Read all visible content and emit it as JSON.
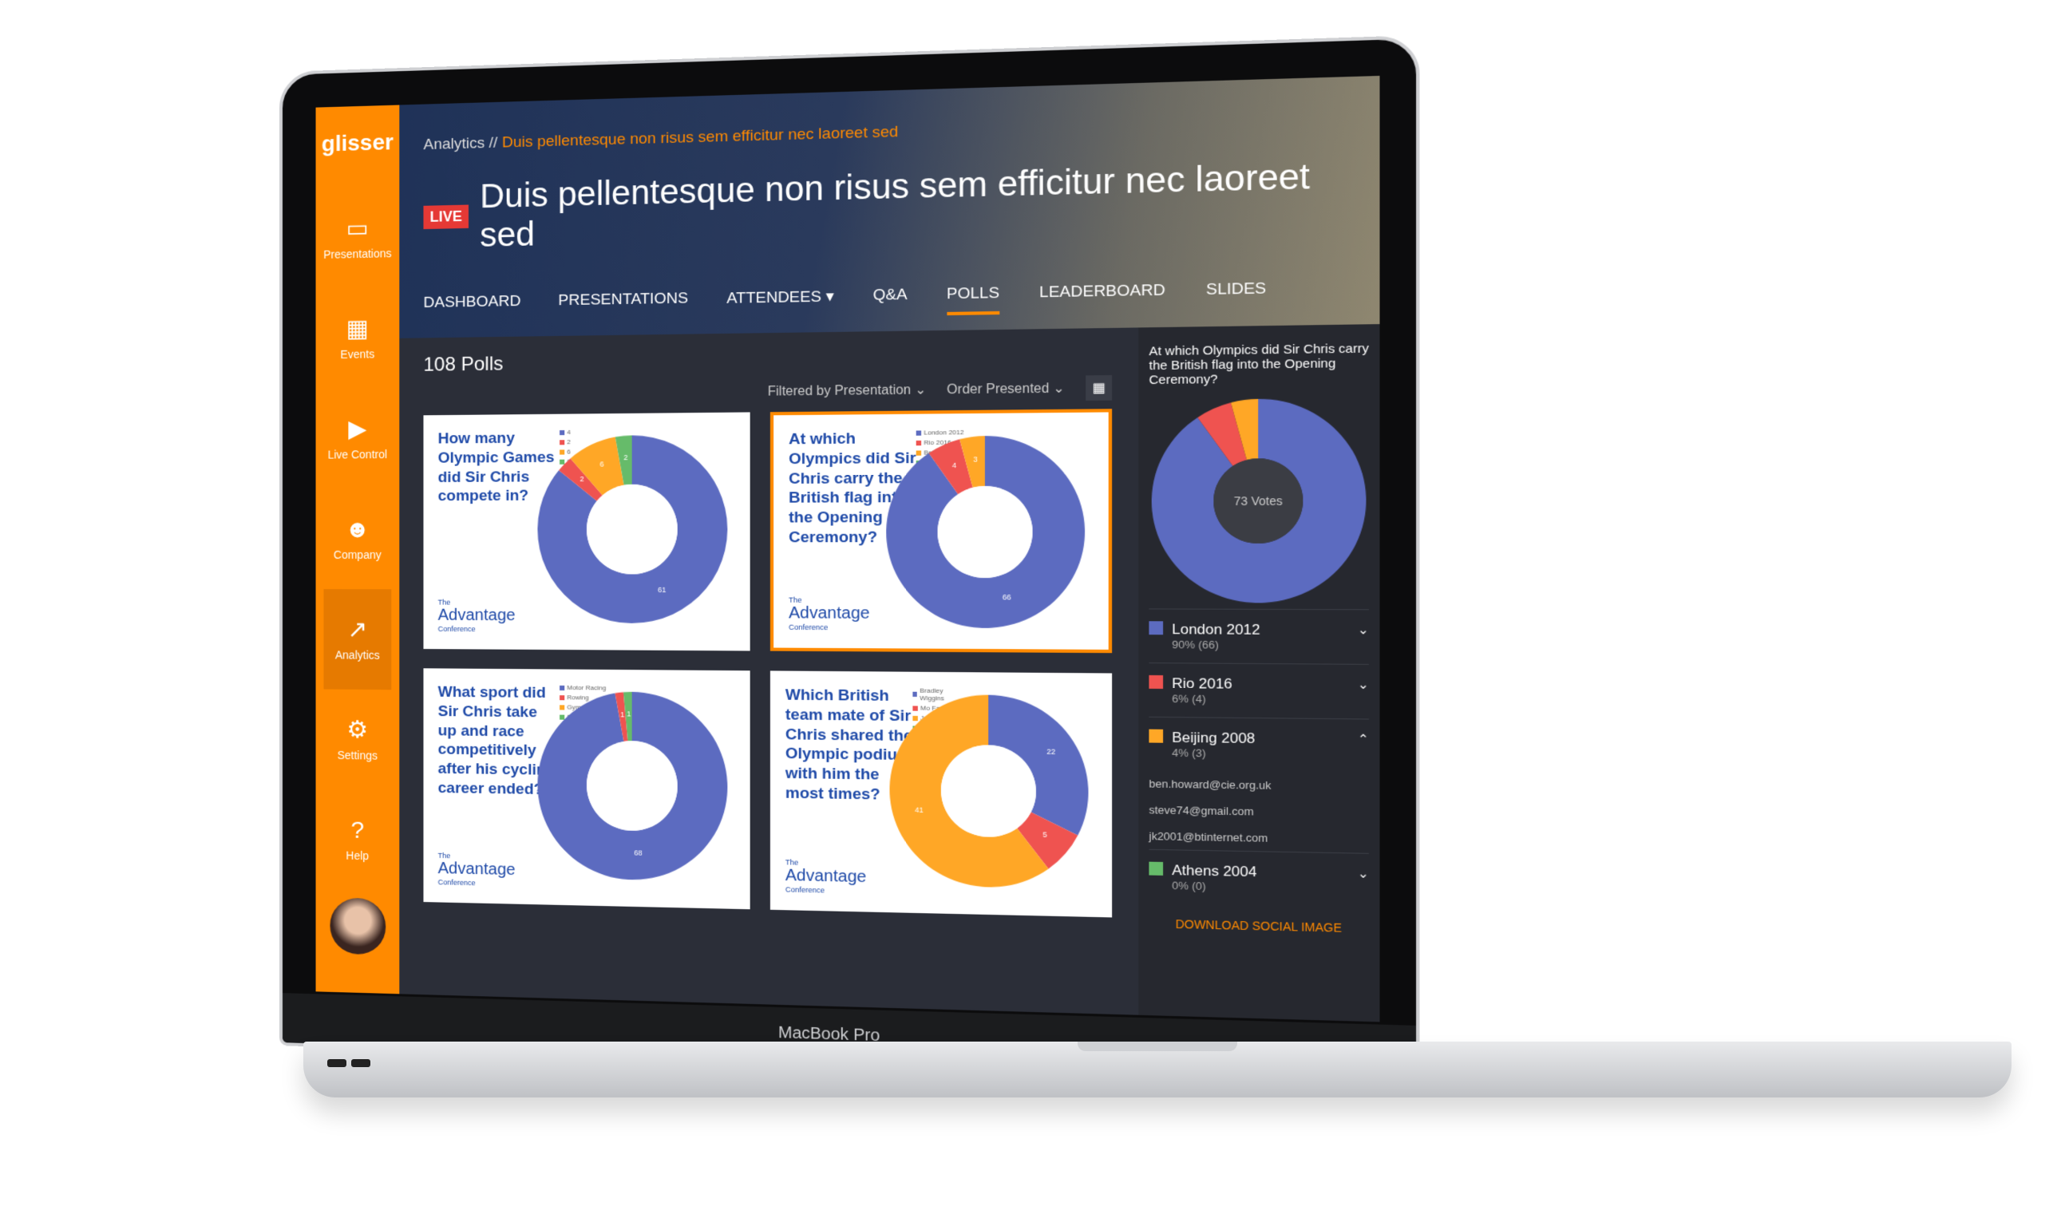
{
  "device_label": "MacBook Pro",
  "sidebar": {
    "logo": "glisser",
    "items": [
      {
        "label": "Presentations",
        "icon": "monitor-icon",
        "glyph": "▭"
      },
      {
        "label": "Events",
        "icon": "calendar-icon",
        "glyph": "▦"
      },
      {
        "label": "Live Control",
        "icon": "play-icon",
        "glyph": "▶"
      },
      {
        "label": "Company",
        "icon": "people-icon",
        "glyph": "☻"
      },
      {
        "label": "Analytics",
        "icon": "chart-icon",
        "glyph": "↗",
        "active": true
      },
      {
        "label": "Settings",
        "icon": "gear-icon",
        "glyph": "⚙"
      },
      {
        "label": "Help",
        "icon": "help-icon",
        "glyph": "?"
      }
    ]
  },
  "header": {
    "breadcrumb_root": "Analytics //",
    "breadcrumb_current": "Duis pellentesque non risus sem efficitur nec laoreet sed",
    "live_badge": "LIVE",
    "title": "Duis pellentesque non risus sem efficitur nec laoreet sed",
    "tabs": [
      "DASHBOARD",
      "PRESENTATIONS",
      "ATTENDEES ▾",
      "Q&A",
      "POLLS",
      "LEADERBOARD",
      "SLIDES"
    ],
    "active_tab": "POLLS"
  },
  "polls": {
    "count": "108 Polls",
    "filter": "Filtered by Presentation ⌄",
    "order": "Order Presented ⌄",
    "brand": {
      "the": "The",
      "name": "Advantage",
      "sub": "Conference"
    },
    "cards": [
      {
        "question": "How many Olympic Games did Sir Chris compete in?",
        "legend": [
          "4",
          "2",
          "6",
          "8"
        ],
        "values": [
          61,
          2,
          6,
          2
        ]
      },
      {
        "question": "At which Olympics did Sir Chris carry the British flag into the Opening Ceremony?",
        "legend": [
          "London 2012",
          "Rio 2016",
          "Beijing 2008",
          "Athens 2004"
        ],
        "values": [
          66,
          4,
          3,
          0
        ],
        "selected": true
      },
      {
        "question": "What sport did Sir Chris take up and race competitively after his cycling career ended?",
        "legend": [
          "Motor Racing",
          "Rowing",
          "Gymnastics",
          "Swimming"
        ],
        "values": [
          68,
          1,
          0,
          1
        ]
      },
      {
        "question": "Which British team mate of Sir Chris shared the Olympic podium with him the most times?",
        "legend": [
          "Bradley Wiggins",
          "Mo Farah",
          "Jason Kenny",
          "Tom Daley"
        ],
        "values": [
          22,
          5,
          41,
          0
        ]
      }
    ]
  },
  "colors": [
    "#5c6bc0",
    "#ef5350",
    "#ffa726",
    "#66bb6a"
  ],
  "panel": {
    "question": "At which Olympics did Sir Chris carry the British flag into the Opening Ceremony?",
    "total": "73 Votes",
    "options": [
      {
        "name": "London 2012",
        "stat": "90% (66)",
        "value": 66,
        "chev": "⌄"
      },
      {
        "name": "Rio 2016",
        "stat": "6% (4)",
        "value": 4,
        "chev": "⌄"
      },
      {
        "name": "Beijing 2008",
        "stat": "4% (3)",
        "value": 3,
        "chev": "⌃",
        "voters": [
          "ben.howard@cie.org.uk",
          "steve74@gmail.com",
          "jk2001@btinternet.com"
        ]
      },
      {
        "name": "Athens 2004",
        "stat": "0% (0)",
        "value": 0,
        "chev": "⌄"
      }
    ],
    "download": "DOWNLOAD SOCIAL IMAGE"
  }
}
